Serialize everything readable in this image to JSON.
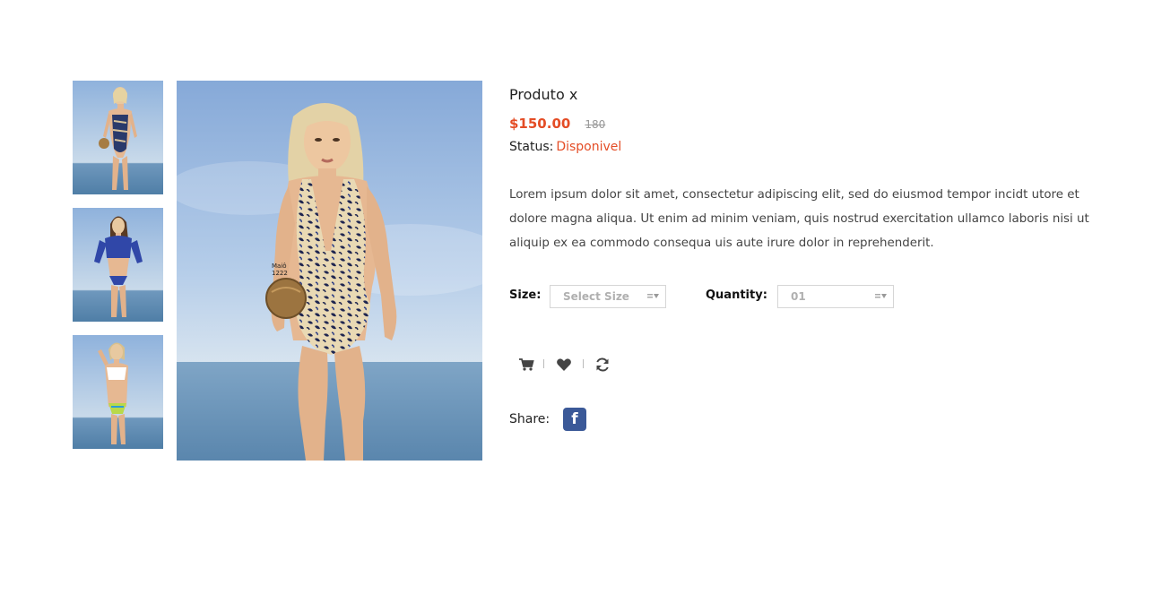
{
  "gallery": {
    "thumbnails": [
      {
        "name": "product-thumbnail-1",
        "alt": "",
        "swimsuit_color": "#2a3a6b"
      },
      {
        "name": "product-thumbnail-2",
        "alt": "",
        "swimsuit_color": "#3047a8"
      },
      {
        "name": "product-thumbnail-3",
        "alt": "",
        "swimsuit_color": "#ffffff"
      }
    ],
    "main_image": {
      "label_line1": "Maiô",
      "label_line2": "1222"
    }
  },
  "product": {
    "title": "Produto x",
    "price": "$150.00",
    "old_price": "180",
    "status_label": "Status:",
    "status_value": "Disponivel",
    "description": "Lorem ipsum dolor sit amet, consectetur adipiscing elit, sed do eiusmod tempor incidt utore et dolore magna aliqua. Ut enim ad minim veniam, quis nostrud exercitation ullamco laboris nisi ut aliquip ex ea commodo consequa uis aute irure dolor in reprehenderit."
  },
  "options": {
    "size_label": "Size:",
    "size_value": "Select Size",
    "quantity_label": "Quantity:",
    "quantity_value": "01"
  },
  "actions": {
    "cart_icon": "cart-icon",
    "wishlist_icon": "heart-icon",
    "compare_icon": "refresh-icon"
  },
  "share": {
    "label": "Share:",
    "facebook_glyph": "f"
  },
  "colors": {
    "accent": "#e44d26",
    "facebook": "#3b5998",
    "sky_top": "#8fb2dc",
    "sea": "#5a86ad"
  }
}
